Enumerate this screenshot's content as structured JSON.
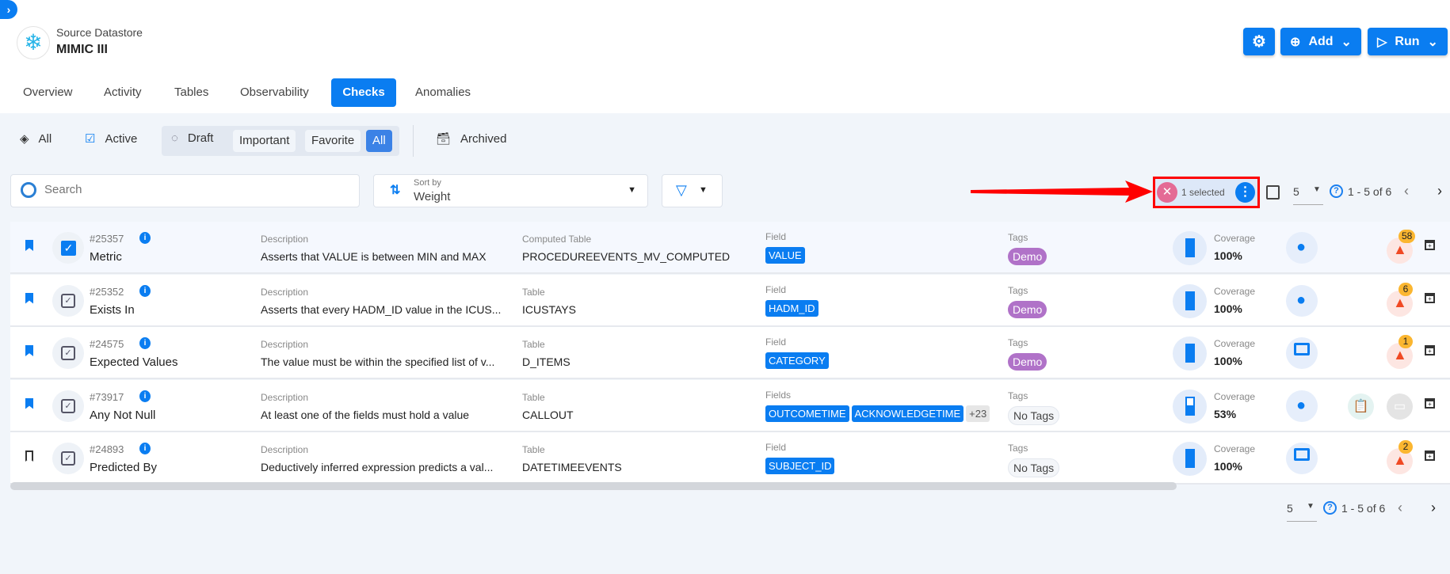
{
  "header": {
    "subtitle": "Source Datastore",
    "title": "MIMIC III",
    "add_label": "Add",
    "run_label": "Run"
  },
  "tabs": [
    {
      "label": "Overview"
    },
    {
      "label": "Activity"
    },
    {
      "label": "Tables"
    },
    {
      "label": "Observability"
    },
    {
      "label": "Checks",
      "active": true
    },
    {
      "label": "Anomalies"
    }
  ],
  "filters": {
    "all": "All",
    "active": "Active",
    "draft": "Draft",
    "important": "Important",
    "favorite": "Favorite",
    "all_sub": "All",
    "archived": "Archived"
  },
  "search": {
    "placeholder": "Search"
  },
  "sort": {
    "label": "Sort by",
    "value": "Weight"
  },
  "selection": {
    "text": "1 selected"
  },
  "pagination": {
    "per_page": "5",
    "range": "1 - 5 of 6"
  },
  "colors": {
    "accent": "#0a7df1",
    "demo_tag": "#b072c8",
    "anomaly": "#f04a24",
    "badge": "#fbb630"
  },
  "rows": [
    {
      "id": "#25357",
      "type": "Metric",
      "desc_label": "Description",
      "desc": "Asserts that VALUE is between MIN and MAX",
      "table_label": "Computed Table",
      "table": "PROCEDUREEVENTS_MV_COMPUTED",
      "field_label": "Field",
      "fields": [
        "VALUE"
      ],
      "more": "",
      "tags_label": "Tags",
      "tag": "Demo",
      "cov_label": "Coverage",
      "coverage": "100%",
      "cov_frac": 1,
      "owner": "user-icon",
      "anomalies": "58",
      "favorite": true,
      "selected": true
    },
    {
      "id": "#25352",
      "type": "Exists In",
      "desc_label": "Description",
      "desc": "Asserts that every HADM_ID value in the ICUS...",
      "table_label": "Table",
      "table": "ICUSTAYS",
      "field_label": "Field",
      "fields": [
        "HADM_ID"
      ],
      "more": "",
      "tags_label": "Tags",
      "tag": "Demo",
      "cov_label": "Coverage",
      "coverage": "100%",
      "cov_frac": 1,
      "owner": "user-icon",
      "anomalies": "6",
      "favorite": true,
      "selected": false
    },
    {
      "id": "#24575",
      "type": "Expected Values",
      "desc_label": "Description",
      "desc": "The value must be within the specified list of v...",
      "table_label": "Table",
      "table": "D_ITEMS",
      "field_label": "Field",
      "fields": [
        "CATEGORY"
      ],
      "more": "",
      "tags_label": "Tags",
      "tag": "Demo",
      "cov_label": "Coverage",
      "coverage": "100%",
      "cov_frac": 1,
      "owner": "monitor-icon",
      "anomalies": "1",
      "favorite": true,
      "selected": false
    },
    {
      "id": "#73917",
      "type": "Any Not Null",
      "desc_label": "Description",
      "desc": "At least one of the fields must hold a value",
      "table_label": "Table",
      "table": "CALLOUT",
      "field_label": "Fields",
      "fields": [
        "OUTCOMETIME",
        "ACKNOWLEDGETIME"
      ],
      "more": "+23",
      "tags_label": "Tags",
      "tag": "No Tags",
      "cov_label": "Coverage",
      "coverage": "53%",
      "cov_frac": 0.53,
      "owner": "user-icon",
      "anomalies": "",
      "favorite": true,
      "selected": false
    },
    {
      "id": "#24893",
      "type": "Predicted By",
      "desc_label": "Description",
      "desc": "Deductively inferred expression predicts a val...",
      "table_label": "Table",
      "table": "DATETIMEEVENTS",
      "field_label": "Field",
      "fields": [
        "SUBJECT_ID"
      ],
      "more": "",
      "tags_label": "Tags",
      "tag": "No Tags",
      "cov_label": "Coverage",
      "coverage": "100%",
      "cov_frac": 1,
      "owner": "monitor-icon",
      "anomalies": "2",
      "favorite": false,
      "selected": false
    }
  ]
}
